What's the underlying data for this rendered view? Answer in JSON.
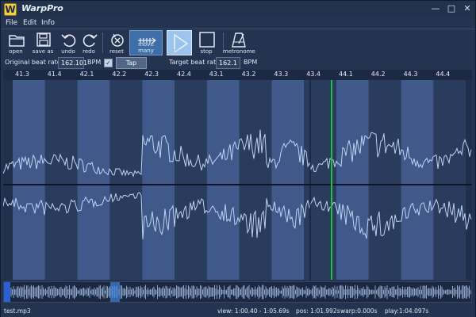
{
  "app": {
    "title": "WarpPro",
    "icon_letter": "W"
  },
  "window_controls": {
    "minimize": "—",
    "maximize": "□",
    "close": "✕"
  },
  "menu": [
    "File",
    "Edit",
    "Info"
  ],
  "toolbar": [
    {
      "label": "open",
      "icon": "folder-icon"
    },
    {
      "label": "save as",
      "icon": "floppy-icon"
    },
    {
      "label": "undo",
      "icon": "undo-icon"
    },
    {
      "label": "redo",
      "icon": "redo-icon"
    },
    {
      "label": "reset",
      "icon": "reset-icon"
    },
    {
      "label": "move many",
      "icon": "move-many-icon",
      "active": true
    },
    {
      "label": "play",
      "icon": "play-icon",
      "active": true
    },
    {
      "label": "stop",
      "icon": "stop-icon"
    },
    {
      "label": "metronome",
      "icon": "metronome-icon"
    }
  ],
  "beat_rate": {
    "original_label": "Original beat rate:",
    "original_value": "162.101",
    "original_unit": "BPM",
    "tap_label": "Tap",
    "target_label": "Target beat rate:",
    "target_value": "162.1",
    "target_unit": "BPM"
  },
  "beat_markers": [
    "41.3",
    "41.4",
    "42.1",
    "42.2",
    "42.3",
    "42.4",
    "43.1",
    "43.2",
    "43.3",
    "43.4",
    "44.1",
    "44.2",
    "44.3",
    "44.4"
  ],
  "colors": {
    "band_light": "#40598a",
    "band_dark": "#2a3c5e",
    "waveform": "#bcd3f2",
    "playhead": "#22c33a",
    "beat_marker": "#3fd24a",
    "overview_selection": "#3d7fd0"
  },
  "status": {
    "file": "test.mp3",
    "view": "view: 1:00.40 - 1:05.69s",
    "pos": "pos: 1:01.992s",
    "warp": "warp:0.000s",
    "play": "play:1:04.097s"
  }
}
